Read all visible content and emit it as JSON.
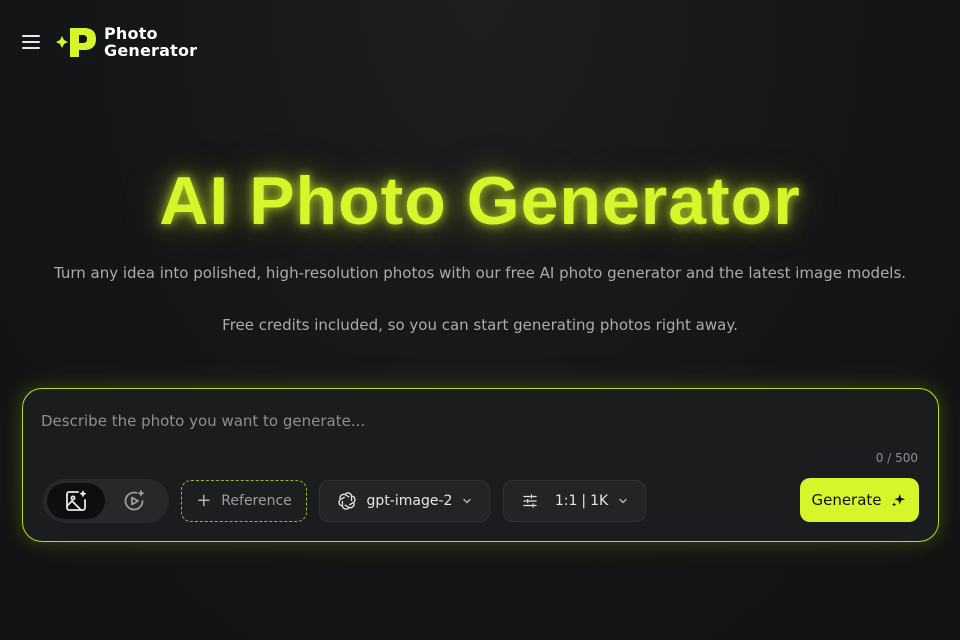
{
  "header": {
    "menu_icon": "hamburger-icon",
    "logo_icon": "sparkle-p-logo-icon",
    "logo_line1": "Photo",
    "logo_line2": "Generator"
  },
  "hero": {
    "title": "AI Photo Generator",
    "subtitle": "Turn any idea into polished, high-resolution photos with our free AI photo generator and the latest image models.",
    "credits_note": "Free credits included, so you can start generating photos right away."
  },
  "prompt": {
    "placeholder": "Describe the photo you want to generate...",
    "value": "",
    "char_count": "0 / 500",
    "modes": [
      {
        "name": "image",
        "icon": "image-sparkle-icon",
        "active": true
      },
      {
        "name": "video",
        "icon": "video-sparkle-icon",
        "active": false
      }
    ],
    "reference_label": "Reference",
    "model_label": "gpt-image-2",
    "model_icon": "openai-icon",
    "ratio_label": "1:1",
    "resolution_label": "1K",
    "ratio_separator": "|",
    "settings_icon": "sliders-icon",
    "generate_label": "Generate",
    "generate_icon": "sparkle-icon"
  },
  "colors": {
    "accent": "#d6f52a",
    "background": "#141516",
    "card": "#1a1c1d"
  }
}
